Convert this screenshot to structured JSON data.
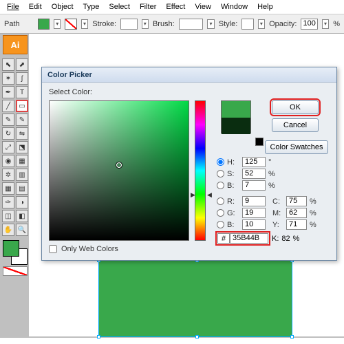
{
  "menu": {
    "file": "File",
    "edit": "Edit",
    "object": "Object",
    "type": "Type",
    "select": "Select",
    "filter": "Filter",
    "effect": "Effect",
    "view": "View",
    "window": "Window",
    "help": "Help"
  },
  "optionsbar": {
    "selection_label": "Path",
    "stroke_label": "Stroke:",
    "brush_label": "Brush:",
    "style_label": "Style:",
    "opacity_label": "Opacity:",
    "opacity_value": "100",
    "percent": "%"
  },
  "app": {
    "logo": "Ai"
  },
  "colors": {
    "fill": "#39a84b",
    "canvas_rect": "#39a84b"
  },
  "dialog": {
    "title": "Color Picker",
    "select_color_label": "Select Color:",
    "ok": "OK",
    "cancel": "Cancel",
    "swatches": "Color Swatches",
    "hsb": {
      "h_label": "H:",
      "h_value": "125",
      "h_unit": "°",
      "s_label": "S:",
      "s_value": "52",
      "s_unit": "%",
      "b_label": "B:",
      "b_value": "7",
      "b_unit": "%"
    },
    "rgb": {
      "r_label": "R:",
      "r_value": "9",
      "g_label": "G:",
      "g_value": "19",
      "b_label": "B:",
      "b_value": "10"
    },
    "cmyk": {
      "c_label": "C:",
      "c_value": "75",
      "m_label": "M:",
      "m_value": "62",
      "y_label": "Y:",
      "y_value": "71",
      "k_label": "K:",
      "k_value": "82",
      "unit": "%"
    },
    "hex_hash": "#",
    "hex_value": "35B44B",
    "only_web_colors": "Only Web Colors"
  }
}
